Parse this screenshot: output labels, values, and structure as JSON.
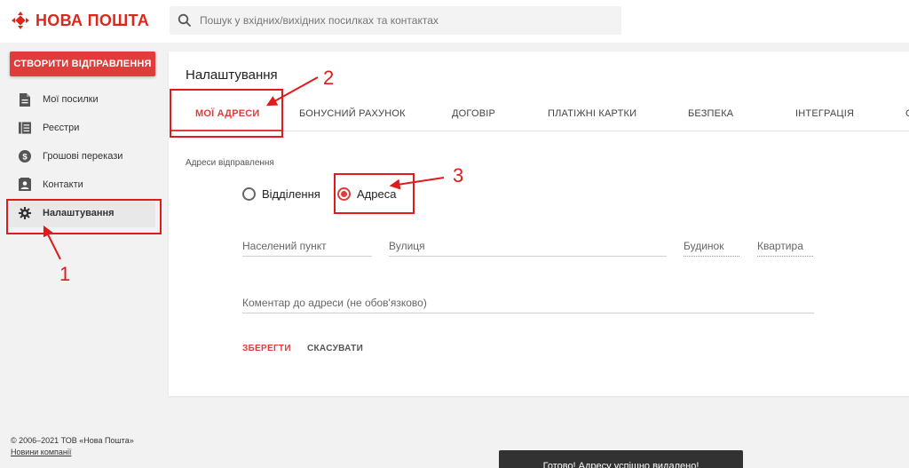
{
  "header": {
    "logo_text": "НОВА ПОШТА",
    "search_placeholder": "Пошук у вхідних/вихідних посилках та контактах"
  },
  "sidebar": {
    "create_label": "СТВОРИТИ ВІДПРАВЛЕННЯ",
    "items": [
      {
        "label": "Мої посилки",
        "icon": "document-icon"
      },
      {
        "label": "Реєстри",
        "icon": "registry-icon"
      },
      {
        "label": "Грошові перекази",
        "icon": "money-icon"
      },
      {
        "label": "Контакти",
        "icon": "contacts-icon"
      },
      {
        "label": "Налаштування",
        "icon": "gear-icon",
        "active": true
      }
    ]
  },
  "footer": {
    "copyright": "© 2006–2021 ТОВ «Нова Пошта»",
    "news_link": "Новини компанії"
  },
  "settings": {
    "title": "Налаштування",
    "tabs": [
      {
        "label": "МОЇ АДРЕСИ",
        "active": true
      },
      {
        "label": "БОНУСНИЙ РАХУНОК"
      },
      {
        "label": "ДОГОВІР"
      },
      {
        "label": "ПЛАТІЖНІ КАРТКИ"
      },
      {
        "label": "БЕЗПЕКА"
      },
      {
        "label": "ІНТЕГРАЦІЯ"
      },
      {
        "label": "С"
      }
    ],
    "section_label": "Адреси відправлення",
    "radio_branch": "Відділення",
    "radio_address": "Адреса",
    "selected": "Адреса",
    "fields": {
      "city": "Населений пункт",
      "street": "Вулиця",
      "house": "Будинок",
      "apartment": "Квартира",
      "comment": "Коментар до адреси (не обов'язково)"
    },
    "save_label": "ЗБЕРЕГТИ",
    "cancel_label": "СКАСУВАТИ"
  },
  "snackbar": {
    "text": "Готово! Адресу успішно видалено!"
  },
  "annotations": {
    "n1": "1",
    "n2": "2",
    "n3": "3",
    "color": "#e01b1b"
  },
  "colors": {
    "brand_red": "#da291c",
    "accent": "#e13c3c",
    "background": "#f2f2f2"
  }
}
